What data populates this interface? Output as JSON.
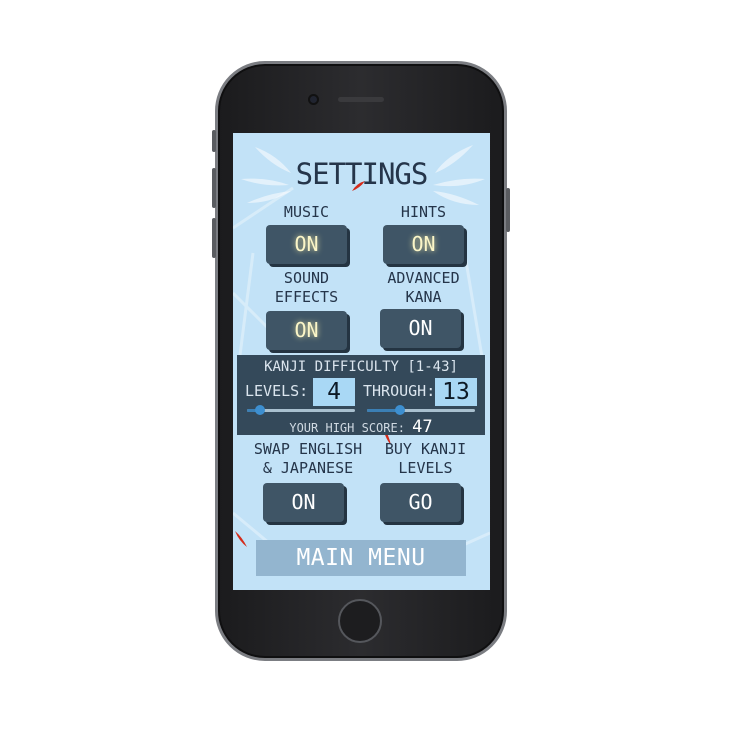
{
  "settings": {
    "title": "SETTINGS",
    "music": {
      "label": "MUSIC",
      "value": "ON"
    },
    "hints": {
      "label": "HINTS",
      "value": "ON"
    },
    "sound_effects": {
      "label_line1": "SOUND",
      "label_line2": "EFFECTS",
      "value": "ON"
    },
    "advanced_kana": {
      "label_line1": "ADVANCED",
      "label_line2": "KANA",
      "value": "ON"
    },
    "kanji": {
      "header": "KANJI DIFFICULTY [1-43]",
      "levels_label": "LEVELS:",
      "levels_value": "4",
      "through_label": "THROUGH:",
      "through_value": "13",
      "high_score_label": "YOUR HIGH SCORE:",
      "high_score_value": "47"
    },
    "swap": {
      "label_line1": "SWAP ENGLISH",
      "label_line2": "& JAPANESE",
      "value": "ON"
    },
    "buy_kanji": {
      "label_line1": "BUY KANJI",
      "label_line2": "LEVELS",
      "value": "GO"
    },
    "main_menu": "MAIN MENU"
  },
  "colors": {
    "screen_bg": "#c2e2f7",
    "button_bg": "#3f5566",
    "panel_bg": "#34495a",
    "accent_red": "#d42b1a",
    "value_box": "#a9d8f5"
  }
}
